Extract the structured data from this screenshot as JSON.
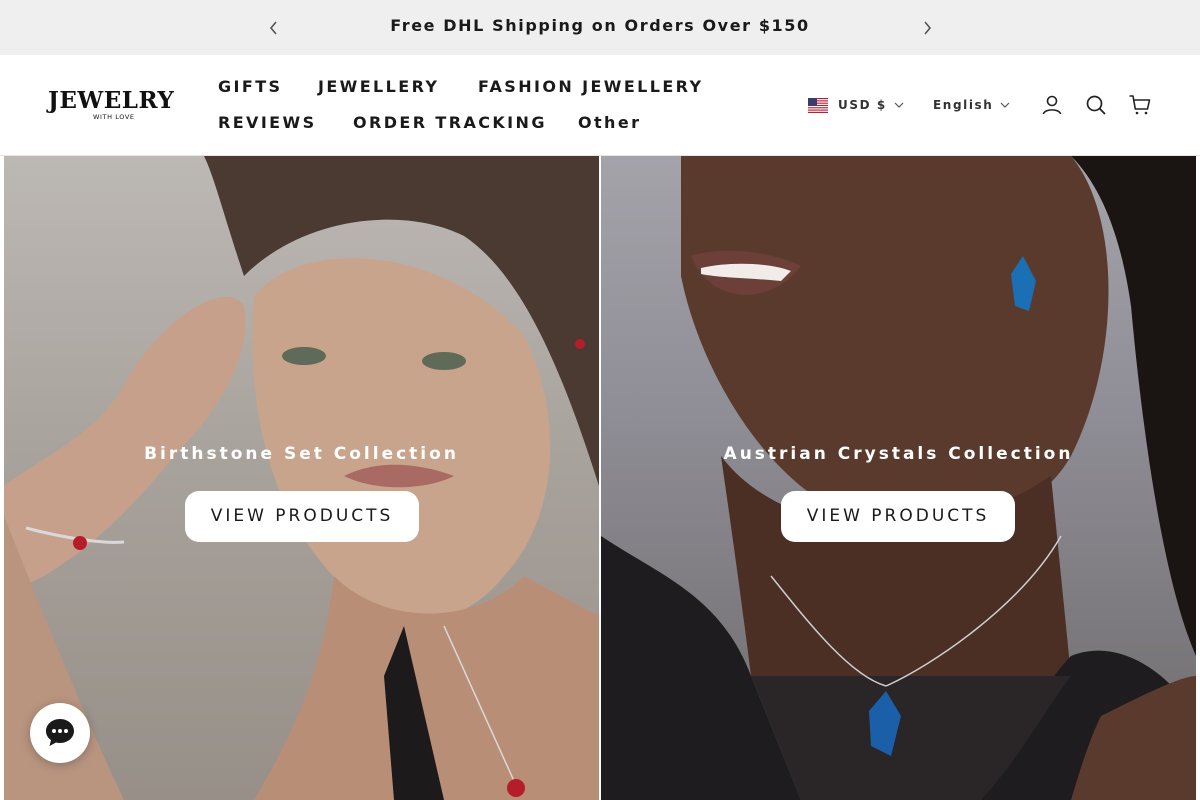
{
  "announcement": {
    "text": "Free DHL Shipping on Orders Over $150"
  },
  "brand": {
    "logo_main": "JEWELRY",
    "logo_sub": "WITH LOVE"
  },
  "nav": {
    "gifts": "GIFTS",
    "jewellery": "JEWELLERY",
    "fashion_jewellery": "FASHION JEWELLERY",
    "reviews": "REVIEWS",
    "order_tracking": "ORDER TRACKING",
    "other": "Other"
  },
  "header_right": {
    "currency": "USD $",
    "language": "English",
    "icons": [
      "account-icon",
      "search-icon",
      "cart-icon"
    ]
  },
  "hero": {
    "left": {
      "title": "Birthstone Set Collection",
      "button": "VIEW PRODUCTS"
    },
    "right": {
      "title": "Austrian Crystals Collection",
      "button": "VIEW PRODUCTS"
    }
  },
  "chat": {
    "icon": "chat-icon"
  },
  "colors": {
    "announcement_bg": "#efefef",
    "text": "#1a1a1a",
    "button_bg": "#ffffff"
  }
}
